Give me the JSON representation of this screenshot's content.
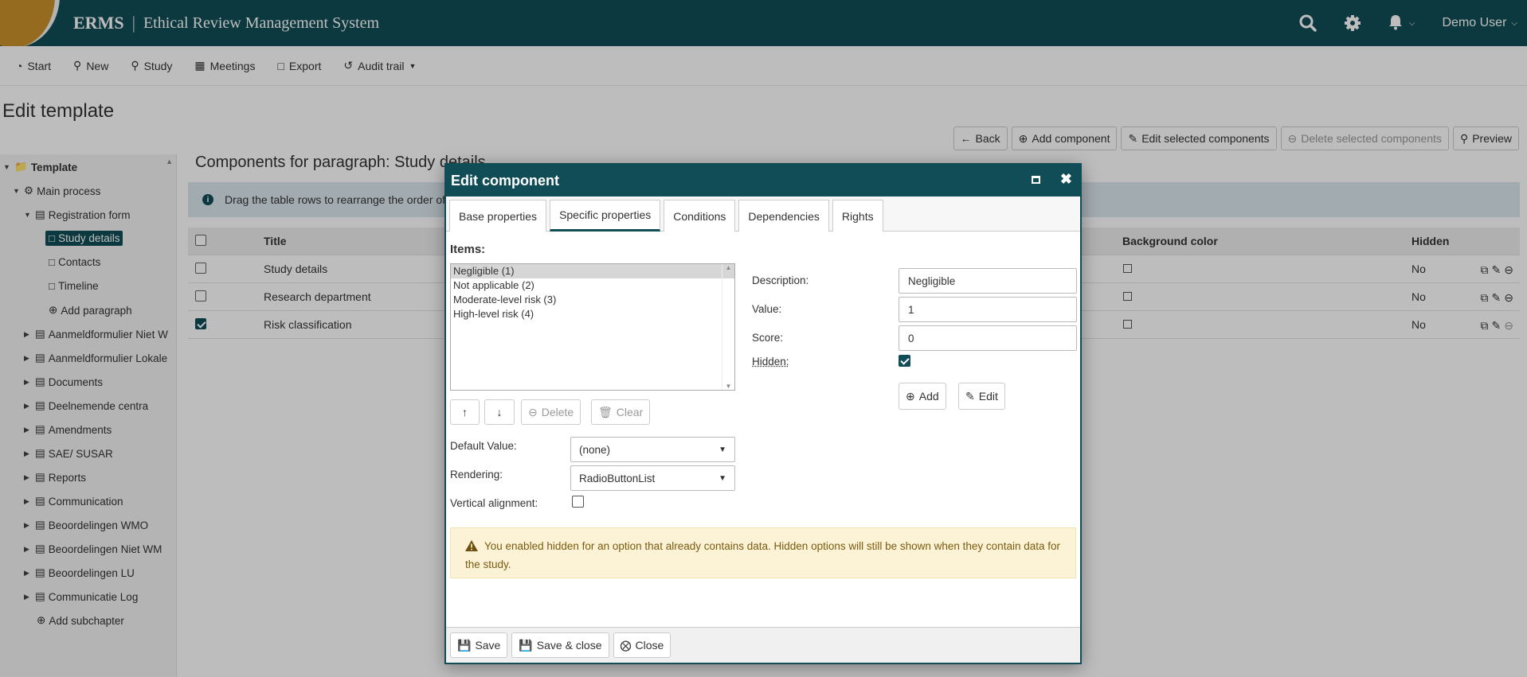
{
  "header": {
    "app_short": "ERMS",
    "app_name": "Ethical Review Management System",
    "user": "Demo User",
    "icons": [
      "search-icon",
      "gear-icon",
      "bell-icon"
    ]
  },
  "nav": {
    "start": "Start",
    "new": "New",
    "study": "Study",
    "meetings": "Meetings",
    "export": "Export",
    "audit": "Audit trail"
  },
  "page": {
    "title": "Edit template"
  },
  "toolbar": {
    "back": "Back",
    "add_component": "Add component",
    "edit_selected": "Edit selected components",
    "delete_selected": "Delete selected components",
    "preview": "Preview"
  },
  "sidebar": {
    "template": "Template",
    "main_process": "Main process",
    "registration_form": "Registration form",
    "study_details": "Study details",
    "contacts": "Contacts",
    "timeline": "Timeline",
    "add_paragraph": "Add paragraph",
    "chapters": [
      "Aanmeldformulier Niet W",
      "Aanmeldformulier Lokale",
      "Documents",
      "Deelnemende centra",
      "Amendments",
      "SAE/ SUSAR",
      "Reports",
      "Communication",
      "Beoordelingen WMO",
      "Beoordelingen Niet WM",
      "Beoordelingen LU",
      "Communicatie Log"
    ],
    "add_subchapter": "Add subchapter"
  },
  "main": {
    "title": "Components for paragraph: Study details",
    "info": "Drag the table rows to rearrange the order of",
    "columns": {
      "title": "Title",
      "bg": "Background color",
      "hidden": "Hidden"
    },
    "rows": [
      {
        "title": "Study details",
        "hidden": "No",
        "checked": false
      },
      {
        "title": "Research department",
        "hidden": "No",
        "checked": false
      },
      {
        "title": "Risk classification",
        "hidden": "No",
        "checked": true
      }
    ]
  },
  "modal": {
    "title": "Edit component",
    "tabs": [
      "Base properties",
      "Specific properties",
      "Conditions",
      "Dependencies",
      "Rights"
    ],
    "items_label": "Items:",
    "items": [
      "Negligible (1)",
      "Not applicable (2)",
      "Moderate-level risk (3)",
      "High-level risk (4)"
    ],
    "delete": "Delete",
    "clear": "Clear",
    "description_label": "Description:",
    "description_value": "Negligible",
    "value_label": "Value:",
    "value_value": "1",
    "score_label": "Score:",
    "score_value": "0",
    "hidden_label": "Hidden:",
    "add": "Add",
    "edit": "Edit",
    "default_label": "Default Value:",
    "default_value": "(none)",
    "rendering_label": "Rendering:",
    "rendering_value": "RadioButtonList",
    "valign_label": "Vertical alignment:",
    "warning": "You enabled hidden for an option that already contains data. Hidden options will still be shown when they contain data for the study.",
    "save": "Save",
    "save_close": "Save & close",
    "close": "Close"
  },
  "colors": {
    "primary": "#114d56",
    "accent": "#c8912a",
    "warning_bg": "#fcf3d6"
  }
}
